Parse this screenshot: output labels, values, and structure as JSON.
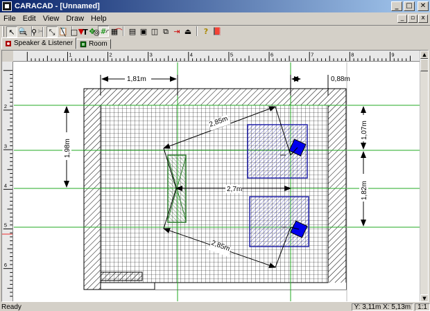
{
  "window": {
    "title": "CARACAD - [Unnamed]"
  },
  "menu": [
    "File",
    "Edit",
    "View",
    "Draw",
    "Help"
  ],
  "window_controls": {
    "minimize": "_",
    "maximize": "□",
    "close": "✕"
  },
  "mdi_controls": {
    "minimize": "_",
    "restore": "▫",
    "close": "x"
  },
  "toolbar1": [
    {
      "name": "new-icon",
      "glyph": "🗋"
    },
    {
      "name": "print-preview-icon",
      "glyph": "🔍"
    },
    {
      "name": "cut-icon",
      "glyph": "✂"
    },
    {
      "name": "copy-icon",
      "glyph": "⎘"
    },
    {
      "name": "paste-icon",
      "glyph": "📋"
    },
    {
      "name": "color-pick-icon",
      "glyph": "▼"
    },
    {
      "name": "snap-icon",
      "glyph": "✥"
    },
    {
      "name": "grid-icon",
      "glyph": "#"
    },
    {
      "name": "hatch-grid-icon",
      "glyph": "▦"
    },
    {
      "name": "layer-icon",
      "glyph": "▤"
    },
    {
      "name": "group-icon",
      "glyph": "▣"
    },
    {
      "name": "stack-icon",
      "glyph": "◫"
    },
    {
      "name": "copy-object-icon",
      "glyph": "⧉"
    },
    {
      "name": "export-icon",
      "glyph": "⇥"
    },
    {
      "name": "exit-icon",
      "glyph": "⏏"
    },
    {
      "name": "help-icon",
      "glyph": "?"
    },
    {
      "name": "book-icon",
      "glyph": "📕"
    }
  ],
  "toolbar2": [
    {
      "name": "select-arrow-icon",
      "glyph": "↖"
    },
    {
      "name": "rectangle-select-icon",
      "glyph": "▭"
    },
    {
      "name": "zoom-icon",
      "glyph": "⚲"
    },
    {
      "name": "dimension-icon",
      "glyph": "⤡"
    },
    {
      "name": "line-icon",
      "glyph": "╲"
    },
    {
      "name": "rectangle-icon",
      "glyph": "□"
    },
    {
      "name": "text-icon",
      "glyph": "T"
    },
    {
      "name": "circle-icon",
      "glyph": "◎"
    },
    {
      "name": "arc-icon",
      "glyph": "◜"
    },
    {
      "name": "curve-icon",
      "glyph": "⌒"
    }
  ],
  "tabs": [
    {
      "label": "Speaker & Listener",
      "active": true
    },
    {
      "label": "Room",
      "active": false
    }
  ],
  "ruler": {
    "top_labels": [
      "1",
      "2",
      "3",
      "4",
      "5",
      "6",
      "7",
      "8",
      "9"
    ],
    "left_labels": [
      "2",
      "3",
      "4",
      "5",
      "6"
    ]
  },
  "drawing": {
    "dimensions": {
      "listener_to_left_wall": "1,81m",
      "speaker_to_right_wall": "0,88m",
      "listener_depth": "1,98m",
      "speaker_top_gap": "1,07m",
      "speaker_spacing": "1,82m",
      "listener_to_top_speaker": "2,85m",
      "listener_to_bottom_speaker": "2,85m",
      "listener_width": "2,7m"
    },
    "colors": {
      "wall_hatch": "#000000",
      "speaker_fill": "#0000ee",
      "speaker_area": "#2222aa",
      "listener_area": "#2a7a2a",
      "guide_green": "#22aa22",
      "guide_red": "#ee2222"
    }
  },
  "status": {
    "left": "Ready",
    "coordinates": "Y: 3,11m X: 5,13m",
    "scale": "1:1"
  }
}
